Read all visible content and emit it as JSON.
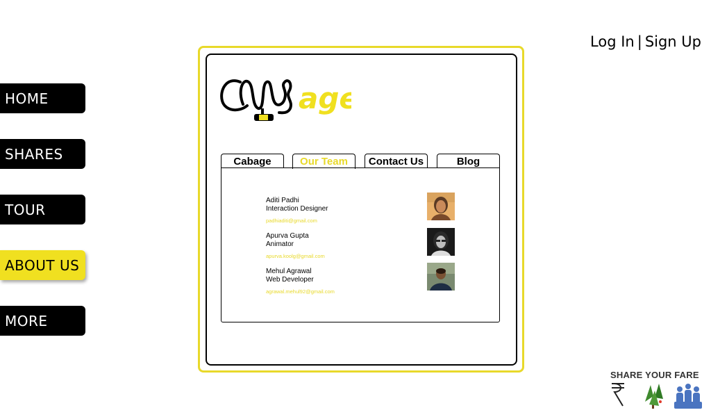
{
  "nav": {
    "items": [
      {
        "label": "HOME"
      },
      {
        "label": "SHARES"
      },
      {
        "label": "TOUR"
      },
      {
        "label": "ABOUT US"
      },
      {
        "label": "MORE"
      }
    ],
    "active_index": 3
  },
  "auth": {
    "login": "Log In",
    "separator": "|",
    "signup": "Sign Up"
  },
  "logo": {
    "suffix": "age"
  },
  "tabs": [
    {
      "label": "Cabage"
    },
    {
      "label": "Our Team"
    },
    {
      "label": "Contact Us"
    },
    {
      "label": "Blog"
    }
  ],
  "team": [
    {
      "name": "Aditi Padhi",
      "role": "Interaction Designer",
      "email": "padhiaditi@gmail.com"
    },
    {
      "name": "Apurva Gupta",
      "role": "Animator",
      "email": "apurva.koolg@gmail.com"
    },
    {
      "name": "Mehul Agrawal",
      "role": "Web Developer",
      "email": "agrawal.mehul92@gmail.com"
    }
  ],
  "footer": {
    "share_title": "SHARE YOUR FARE"
  },
  "colors": {
    "accent": "#e8d92a",
    "nav_bg": "#000000"
  }
}
